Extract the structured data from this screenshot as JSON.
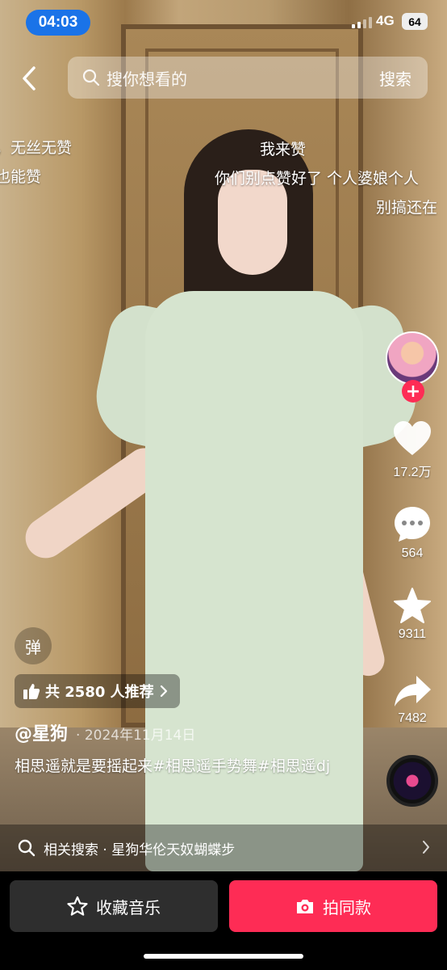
{
  "status_bar": {
    "time": "04:03",
    "network": "4G",
    "battery": "64"
  },
  "search": {
    "placeholder": "搜你想看的",
    "button_label": "搜索"
  },
  "danmaku": [
    {
      "text": "，无丝无赞"
    },
    {
      "text": "也能赞"
    },
    {
      "text": "我来赞"
    },
    {
      "text": "你们别点赞好了 个人婆娘个人"
    },
    {
      "text": "别搞还在"
    }
  ],
  "actions": {
    "likes": "17.2万",
    "comments": "564",
    "favorites": "9311",
    "shares": "7482"
  },
  "overlay": {
    "danmu_toggle": "弹",
    "recommend": "共 2580 人推荐",
    "author": "@星狗",
    "date": "· 2024年11月14日",
    "caption": "相思遥就是要摇起来#相思遥手势舞#相思遥dj"
  },
  "related_search": {
    "text": "相关搜索 · 星狗华伦天奴蝴蝶步"
  },
  "bottom_bar": {
    "collect_music": "收藏音乐",
    "shoot_same": "拍同款"
  },
  "colors": {
    "accent": "#fe2c55",
    "time_pill": "#1a73e8"
  }
}
